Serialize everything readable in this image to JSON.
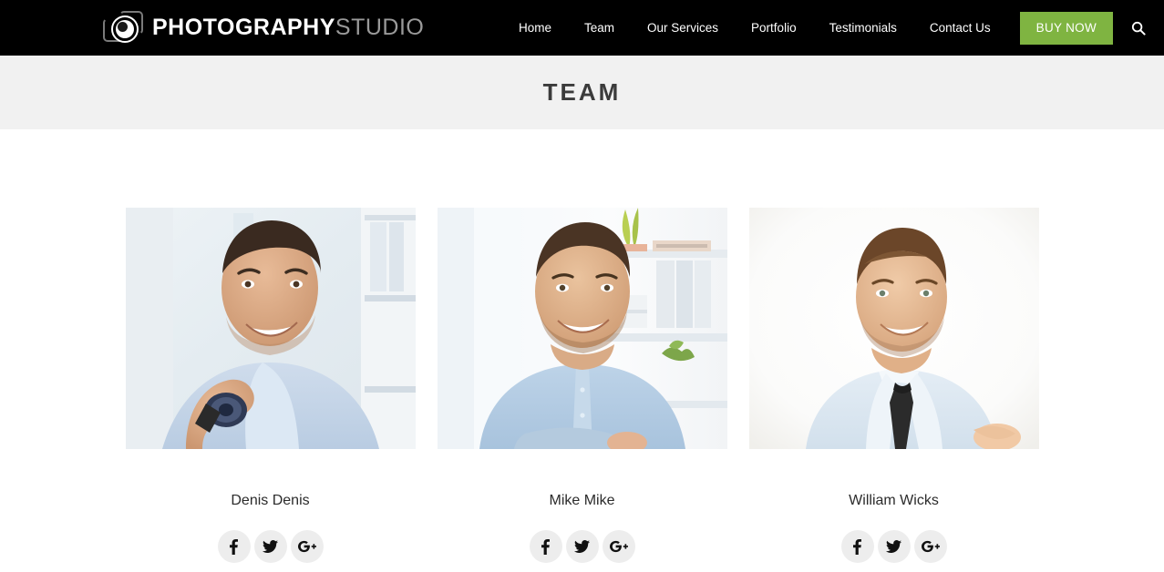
{
  "header": {
    "logo": {
      "icon": "camera-lens-icon",
      "text_bold": "PHOTOGRAPHY",
      "text_light": "STUDIO"
    },
    "nav_items": [
      {
        "label": "Home"
      },
      {
        "label": "Team"
      },
      {
        "label": "Our Services"
      },
      {
        "label": "Portfolio"
      },
      {
        "label": "Testimonials"
      },
      {
        "label": "Contact Us"
      }
    ],
    "buy_now_label": "BUY NOW",
    "search_icon": "search-icon",
    "background_color": "#000000",
    "accent_color": "#7fb441"
  },
  "banner": {
    "title": "TEAM",
    "background_color": "#f1f1f1",
    "title_color": "#3b3b3b"
  },
  "team": {
    "members": [
      {
        "name": "Denis Denis",
        "photo_alt": "smiling man in light blue shirt with wristwatch in office",
        "social": [
          {
            "icon": "facebook-icon",
            "label": "f"
          },
          {
            "icon": "twitter-icon",
            "label": "twitter"
          },
          {
            "icon": "google-plus-icon",
            "label": "G+"
          }
        ]
      },
      {
        "name": "Mike Mike",
        "photo_alt": "smiling man in light blue shirt with arms crossed by bookshelf",
        "social": [
          {
            "icon": "facebook-icon",
            "label": "f"
          },
          {
            "icon": "twitter-icon",
            "label": "twitter"
          },
          {
            "icon": "google-plus-icon",
            "label": "G+"
          }
        ]
      },
      {
        "name": "William Wicks",
        "photo_alt": "smiling man in white shirt and dark tie on white background",
        "social": [
          {
            "icon": "facebook-icon",
            "label": "f"
          },
          {
            "icon": "twitter-icon",
            "label": "twitter"
          },
          {
            "icon": "google-plus-icon",
            "label": "G+"
          }
        ]
      }
    ],
    "social_circle_color": "#ededed",
    "name_color": "#2b2b2b"
  }
}
